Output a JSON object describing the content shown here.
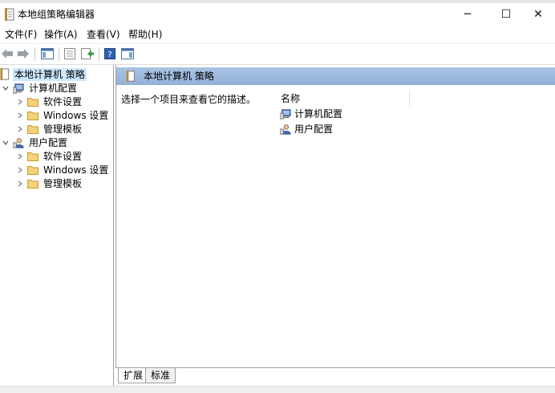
{
  "window": {
    "title": "本地组策略编辑器",
    "controls": {
      "minimize": "─",
      "maximize": "☐",
      "close": "✕"
    }
  },
  "menu": [
    "文件(F)",
    "操作(A)",
    "查看(V)",
    "帮助(H)"
  ],
  "tree": {
    "root": "本地计算机 策略",
    "computer": {
      "label": "计算机配置",
      "children": [
        "软件设置",
        "Windows 设置",
        "管理模板"
      ]
    },
    "user": {
      "label": "用户配置",
      "children": [
        "软件设置",
        "Windows 设置",
        "管理模板"
      ]
    }
  },
  "details": {
    "header": "本地计算机 策略",
    "description": "选择一个项目来查看它的描述。",
    "column_name": "名称",
    "items": [
      "计算机配置",
      "用户配置"
    ]
  },
  "tabs": [
    "扩展",
    "标准"
  ],
  "colors": {
    "header_bg": "#9db9dd",
    "selection": "#cce8ff",
    "folder": "#e8c35a"
  }
}
